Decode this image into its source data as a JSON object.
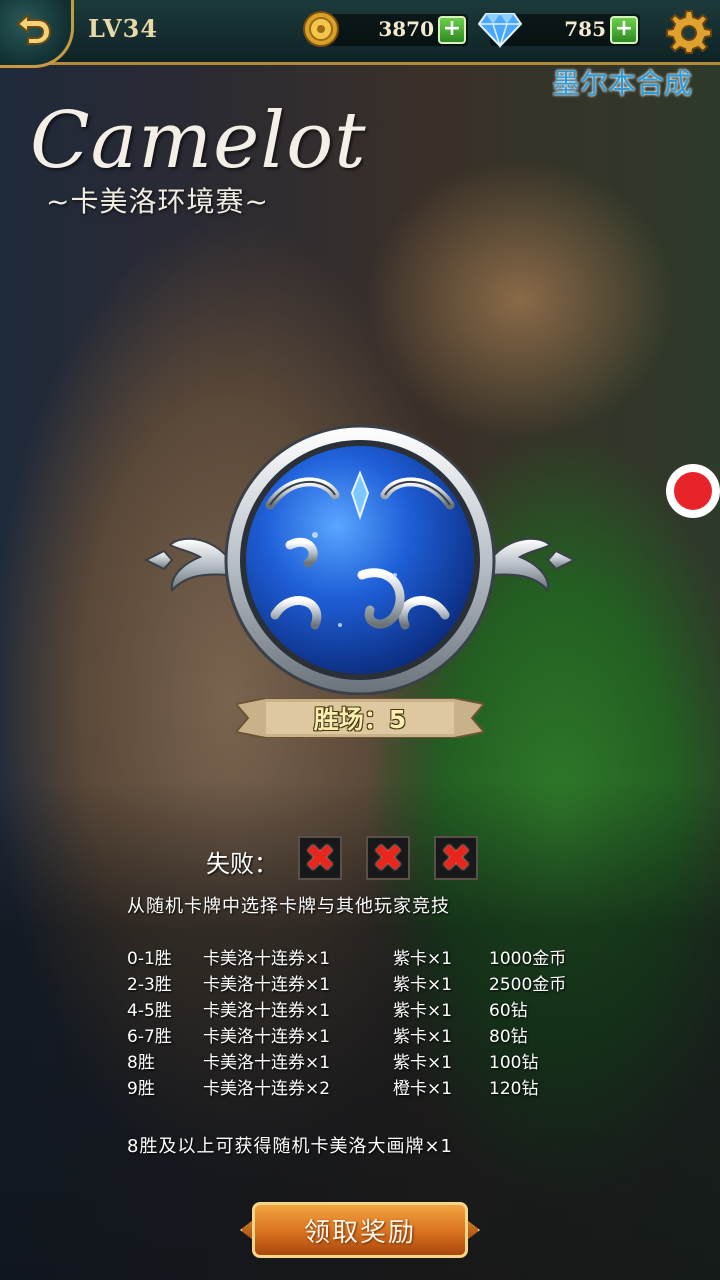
{
  "header": {
    "level": "LV34",
    "coins": "3870",
    "gems": "785",
    "plus": "+"
  },
  "notice_text": "墨尔本合成",
  "title": {
    "english": "Camelot",
    "chinese": "~卡美洛环境赛~"
  },
  "wins": {
    "label": "胜场：",
    "value": "5"
  },
  "losses": {
    "label": "失败：",
    "marks": [
      "✖",
      "✖",
      "✖"
    ]
  },
  "description": "从随机卡牌中选择卡牌与其他玩家竞技",
  "rewards": [
    {
      "wins": "0-1胜",
      "tickets": "卡美洛十连券×1",
      "card": "紫卡×1",
      "prize": "1000金币"
    },
    {
      "wins": "2-3胜",
      "tickets": "卡美洛十连券×1",
      "card": "紫卡×1",
      "prize": "2500金币"
    },
    {
      "wins": "4-5胜",
      "tickets": "卡美洛十连券×1",
      "card": "紫卡×1",
      "prize": "60钻"
    },
    {
      "wins": "6-7胜",
      "tickets": "卡美洛十连券×1",
      "card": "紫卡×1",
      "prize": "80钻"
    },
    {
      "wins": "8胜",
      "tickets": "卡美洛十连券×1",
      "card": "紫卡×1",
      "prize": "100钻"
    },
    {
      "wins": "9胜",
      "tickets": "卡美洛十连券×2",
      "card": "橙卡×1",
      "prize": "120钻"
    }
  ],
  "bonus_text": "8胜及以上可获得随机卡美洛大画牌×1",
  "claim_button": "领取奖励",
  "colors": {
    "accent_gold": "#c89a44",
    "claim_orange": "#d9701e",
    "loss_red": "#e8261e",
    "emblem_blue": "#1f5fd8"
  },
  "icons": [
    "back-arrow-icon",
    "coin-icon",
    "diamond-icon",
    "gear-icon",
    "record-icon"
  ]
}
